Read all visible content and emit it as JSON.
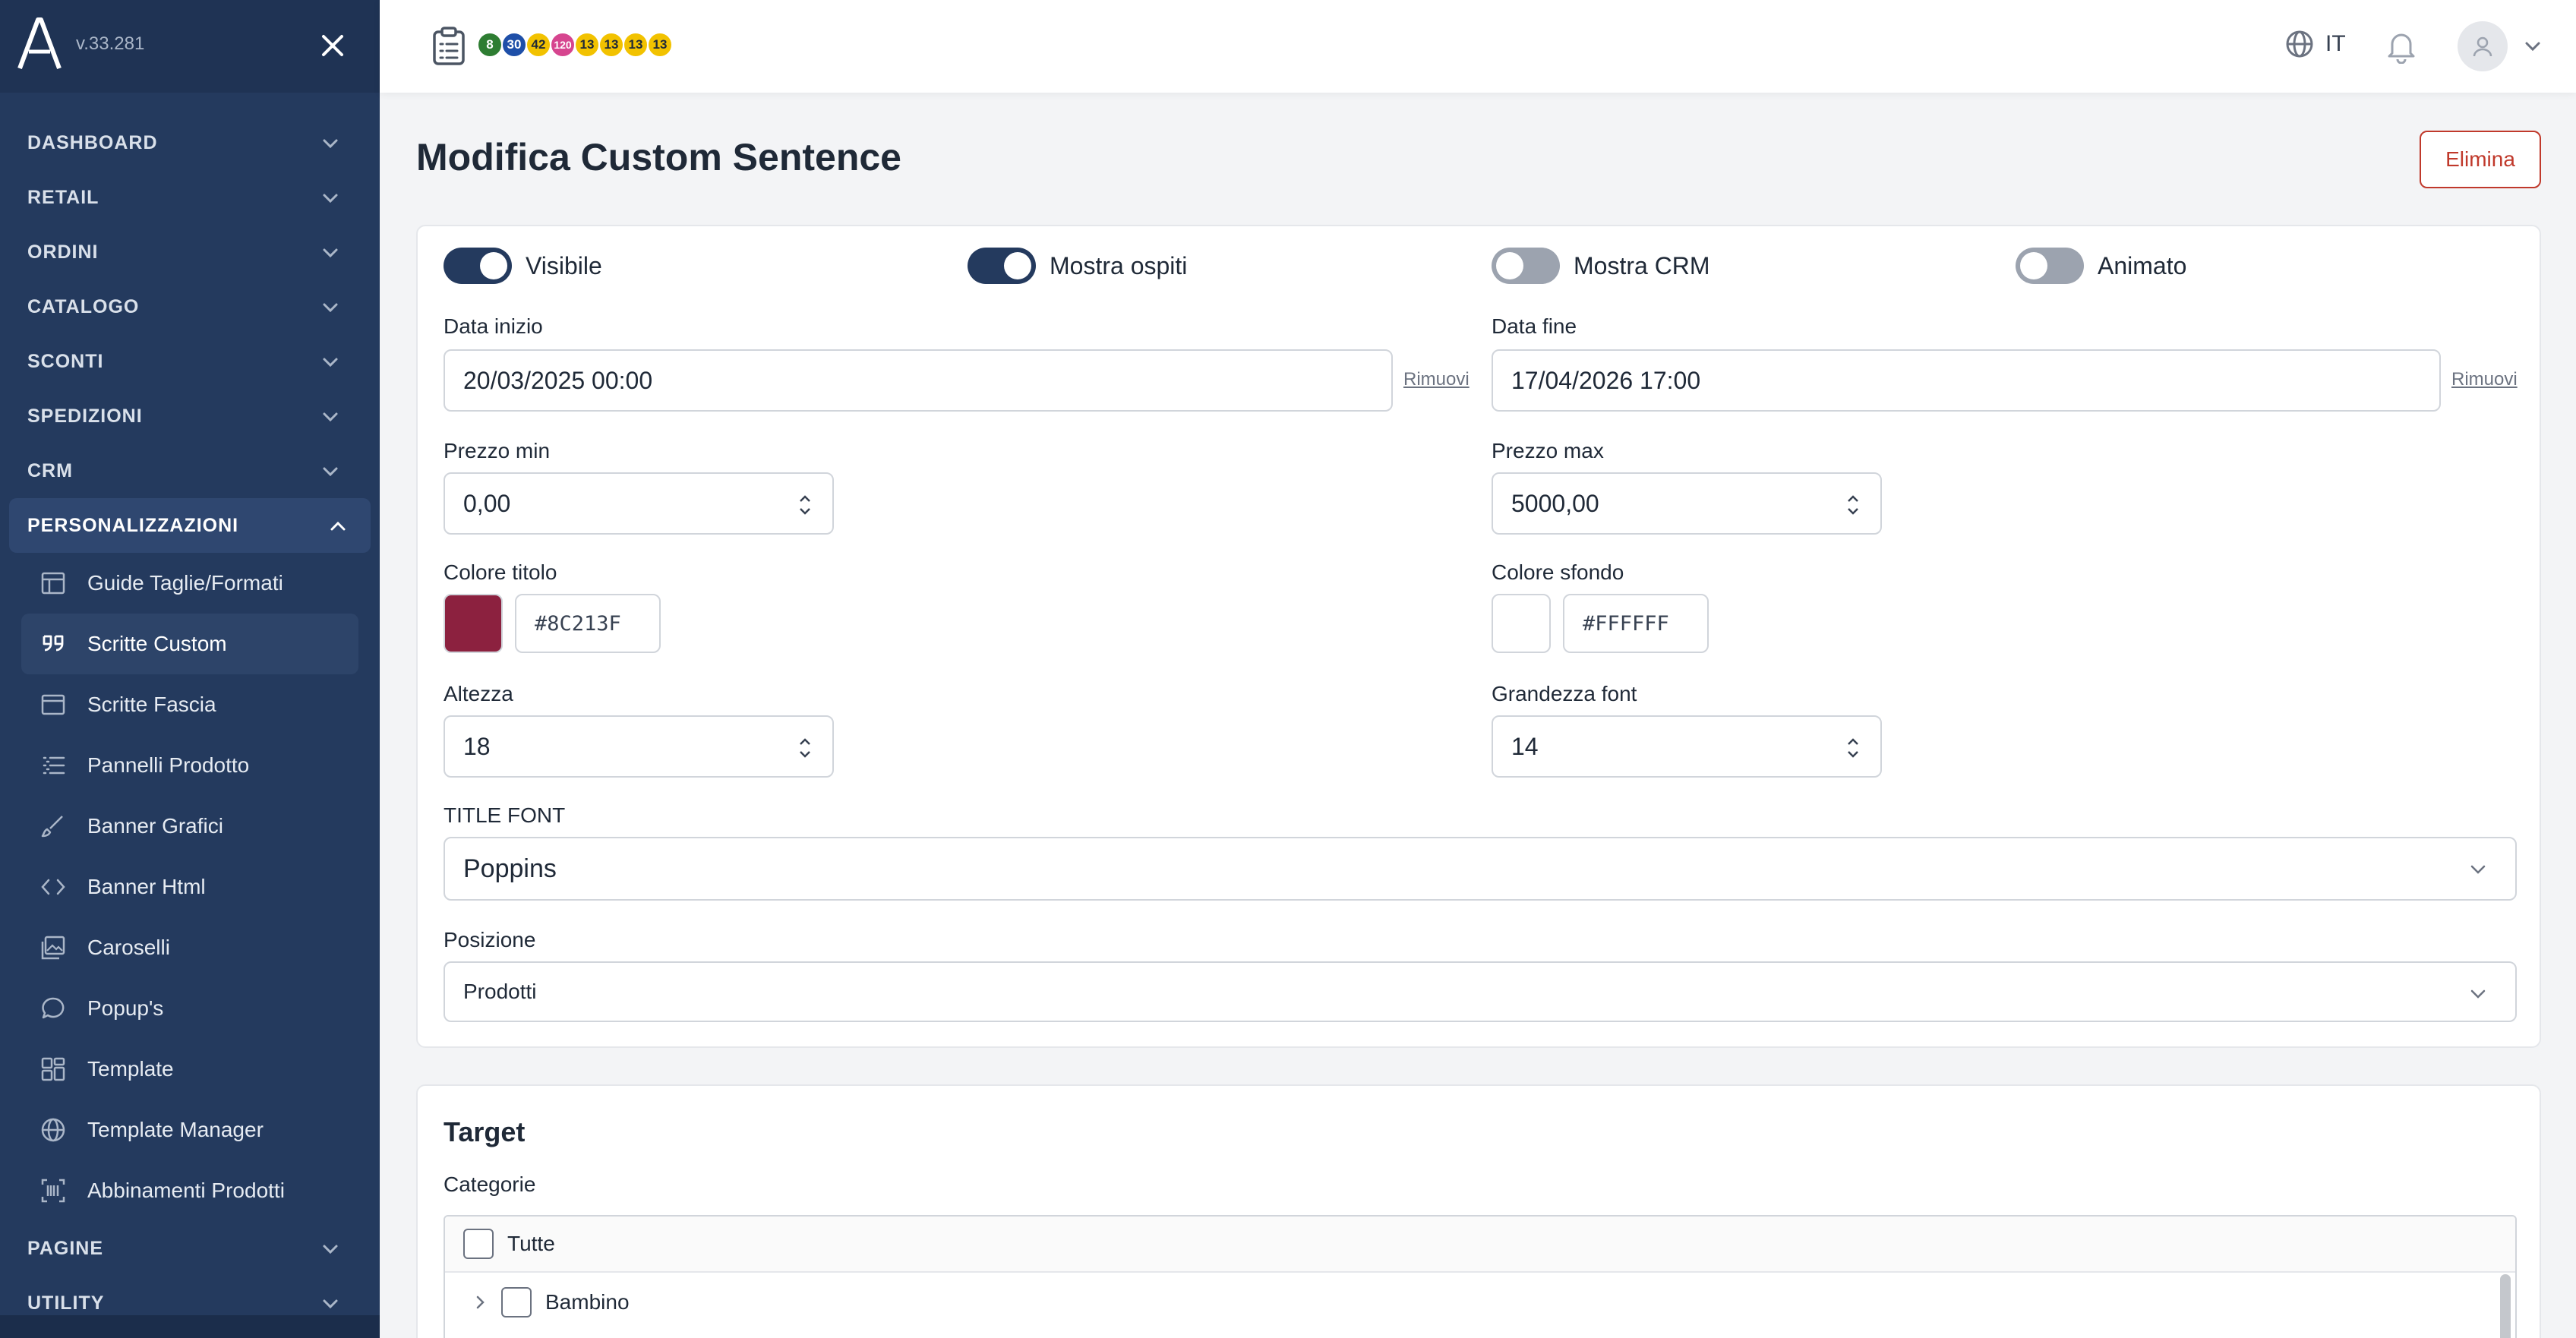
{
  "app": {
    "version": "v.33.281"
  },
  "sidebar": {
    "sections_top": [
      {
        "label": "DASHBOARD"
      },
      {
        "label": "RETAIL"
      },
      {
        "label": "ORDINI"
      },
      {
        "label": "CATALOGO"
      },
      {
        "label": "SCONTI"
      },
      {
        "label": "SPEDIZIONI"
      },
      {
        "label": "CRM"
      }
    ],
    "open_section": {
      "label": "PERSONALIZZAZIONI"
    },
    "sub_items": [
      {
        "label": "Guide Taglie/Formati",
        "icon": "table-icon"
      },
      {
        "label": "Scritte Custom",
        "icon": "quote-icon",
        "active": true
      },
      {
        "label": "Scritte Fascia",
        "icon": "banner-strip-icon"
      },
      {
        "label": "Pannelli Prodotto",
        "icon": "list-icon"
      },
      {
        "label": "Banner Grafici",
        "icon": "brush-icon"
      },
      {
        "label": "Banner Html",
        "icon": "code-icon"
      },
      {
        "label": "Caroselli",
        "icon": "images-icon"
      },
      {
        "label": "Popup's",
        "icon": "chat-bubble-icon"
      },
      {
        "label": "Template",
        "icon": "layout-icon"
      },
      {
        "label": "Template Manager",
        "icon": "globe-icon"
      },
      {
        "label": "Abbinamenti Prodotti",
        "icon": "barcode-icon"
      }
    ],
    "sections_bottom": [
      {
        "label": "PAGINE"
      },
      {
        "label": "UTILITY"
      }
    ]
  },
  "topbar": {
    "badges": [
      {
        "value": "8",
        "color": "#2e7d32",
        "text": "#ffffff"
      },
      {
        "value": "30",
        "color": "#1e4fa8",
        "text": "#ffffff"
      },
      {
        "value": "42",
        "color": "#f2c200",
        "text": "#1f2937"
      },
      {
        "value": "120",
        "color": "#d6458f",
        "text": "#ffffff"
      },
      {
        "value": "13",
        "color": "#f2c200",
        "text": "#1f2937"
      },
      {
        "value": "13",
        "color": "#f2c200",
        "text": "#1f2937"
      },
      {
        "value": "13",
        "color": "#f2c200",
        "text": "#1f2937"
      },
      {
        "value": "13",
        "color": "#f2c200",
        "text": "#1f2937"
      }
    ],
    "language": "IT"
  },
  "page": {
    "title": "Modifica Custom Sentence",
    "delete_label": "Elimina"
  },
  "form": {
    "toggles": [
      {
        "label": "Visibile",
        "on": true
      },
      {
        "label": "Mostra ospiti",
        "on": true
      },
      {
        "label": "Mostra CRM",
        "on": false
      },
      {
        "label": "Animato",
        "on": false
      }
    ],
    "start_date": {
      "label": "Data inizio",
      "value": "20/03/2025 00:00",
      "remove": "Rimuovi"
    },
    "end_date": {
      "label": "Data fine",
      "value": "17/04/2026 17:00",
      "remove": "Rimuovi"
    },
    "min_price": {
      "label": "Prezzo min",
      "value": "0,00"
    },
    "max_price": {
      "label": "Prezzo max",
      "value": "5000,00"
    },
    "title_color": {
      "label": "Colore titolo",
      "value": "#8C213F"
    },
    "bg_color": {
      "label": "Colore sfondo",
      "value": "#FFFFFF"
    },
    "height": {
      "label": "Altezza",
      "value": "18"
    },
    "font_size": {
      "label": "Grandezza font",
      "value": "14"
    },
    "title_font": {
      "label": "TITLE FONT",
      "value": "Poppins"
    },
    "position": {
      "label": "Posizione",
      "value": "Prodotti"
    }
  },
  "target": {
    "title": "Target",
    "categories_label": "Categorie",
    "all_label": "Tutte",
    "first_category": "Bambino"
  }
}
